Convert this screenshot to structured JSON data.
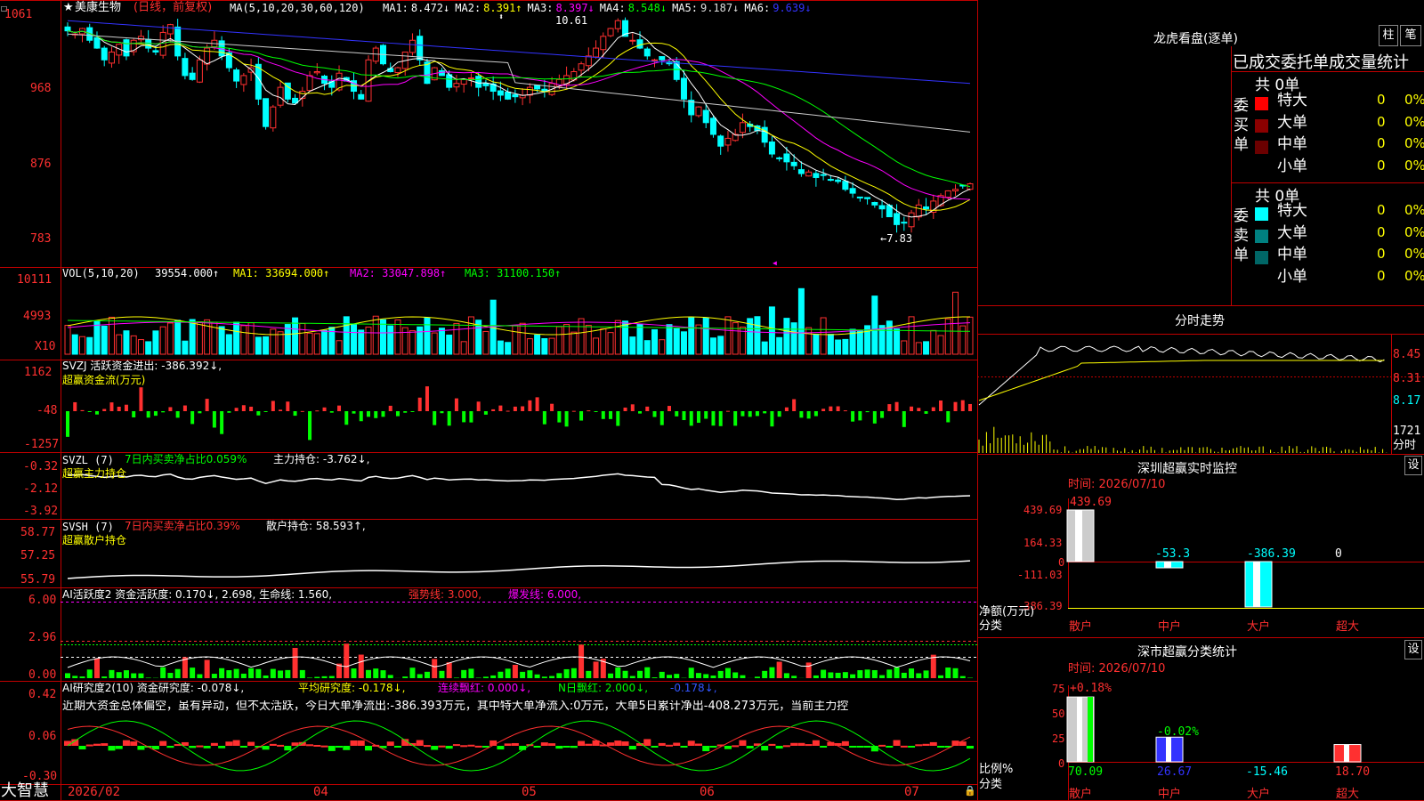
{
  "app": {
    "name": "大智慧"
  },
  "stock": {
    "name": "美康生物",
    "mode": "(日线，前复权)"
  },
  "main_panel": {
    "label": "MA(5,10,20,30,60,120)",
    "ma_readouts": [
      {
        "name": "MA1:",
        "value": "8.472↓",
        "color": "#ffffff"
      },
      {
        "name": "MA2:",
        "value": "8.391↑",
        "color": "#ffff00"
      },
      {
        "name": "MA3:",
        "value": "8.397↓",
        "color": "#ff00ff"
      },
      {
        "name": "MA4:",
        "value": "8.548↓",
        "color": "#00ff00"
      },
      {
        "name": "MA5:",
        "value": "9.187↓",
        "color": "#dddddd"
      },
      {
        "name": "MA6:",
        "value": "9.639↓",
        "color": "#3333ff"
      }
    ],
    "y_ticks": [
      "1061",
      "968",
      "876",
      "783"
    ],
    "high_label": "10.61",
    "low_label": "←7.83"
  },
  "vol_panel": {
    "label": "VOL(5,10,20)",
    "value": "39554.000↑",
    "ma1": "MA1: 33694.000↑",
    "ma2": "MA2: 33047.898↑",
    "ma3": "MA3: 31100.150↑",
    "y_ticks": [
      "10111",
      "4993"
    ],
    "unit": "X10"
  },
  "svzj_panel": {
    "label": "SVZJ  活跃资金进出: -386.392↓,",
    "sub": "超赢资金流(万元)",
    "y_ticks": [
      "1162",
      "-48",
      "-1257"
    ]
  },
  "svzl_panel": {
    "label": "SVZL (7)",
    "ratio": "7日内买卖净占比0.059%",
    "hold": "主力持仓: -3.762↓,",
    "sub": "超赢主力持仓",
    "y_ticks": [
      "-0.32",
      "-2.12",
      "-3.92"
    ]
  },
  "svsh_panel": {
    "label": "SVSH (7)",
    "ratio": "7日内买卖净占比0.39%",
    "hold": "散户持仓: 58.593↑,",
    "sub": "超赢散户持仓",
    "y_ticks": [
      "58.77",
      "57.25",
      "55.79"
    ]
  },
  "ai_active_panel": {
    "label": "AI活跃度2 资金活跃度: 0.170↓, 2.698, 生命线: 1.560,",
    "strong": "强势线: 3.000,",
    "burst": "爆发线: 6.000,",
    "y_ticks": [
      "6.00",
      "2.96",
      "0.00"
    ]
  },
  "ai_research_panel": {
    "label": "AI研究度2(10) 资金研究度: -0.078↓,",
    "avg": "平均研究度: -0.178↓,",
    "cont": "连续飘红: 0.000↓,",
    "nday": "N日飘红: 2.000↓,",
    "last": "-0.178↓,",
    "comment": "近期大资金总体偏空，虽有异动，但不太活跃，今日大单净流出:-386.393万元，其中特大单净流入:0万元，大单5日累计净出-408.273万元，当前主力控",
    "y_ticks": [
      "0.42",
      "0.06",
      "-0.30"
    ]
  },
  "x_axis": {
    "labels": [
      "2026/02",
      "04",
      "05",
      "06",
      "07"
    ]
  },
  "dragon_tiger": {
    "title": "龙虎看盘(逐单)",
    "btn_bar": "柱",
    "btn_pen": "笔",
    "header": "已成交委托单成交量统计",
    "buy_side": "委买单",
    "sell_side": "委卖单",
    "buy_total": "共 0单",
    "sell_total": "共 0单",
    "rows": [
      {
        "label": "特大",
        "value": "0",
        "pct": "0%"
      },
      {
        "label": "大单",
        "value": "0",
        "pct": "0%"
      },
      {
        "label": "中单",
        "value": "0",
        "pct": "0%"
      },
      {
        "label": "小单",
        "value": "0",
        "pct": "0%"
      }
    ],
    "buy_colors": [
      "#ff0000",
      "#8b0000",
      "#6b0000",
      ""
    ],
    "sell_colors": [
      "#00ffff",
      "#008080",
      "#006666",
      ""
    ]
  },
  "intraday": {
    "title": "分时走势",
    "y_ticks": [
      "8.45",
      "8.31",
      "8.17"
    ],
    "vol_tick": "1721",
    "vol_label": "分时"
  },
  "sz_monitor": {
    "title": "深圳超赢实时监控",
    "btn": "设",
    "time": "时间: 2026/07/10",
    "y_ticks": [
      "439.69",
      "164.33",
      "0",
      "-111.03",
      "-386.39"
    ],
    "y_label": "净额(万元)",
    "x_label_title": "分类",
    "categories": [
      "散户",
      "中户",
      "大户",
      "超大"
    ],
    "value_labels": [
      "439.69",
      "-53.3",
      "-386.39",
      "0"
    ]
  },
  "sz_classify": {
    "title": "深市超赢分类统计",
    "btn": "设",
    "time": "时间: 2026/07/10",
    "y_ticks": [
      "75",
      "50",
      "25",
      "0"
    ],
    "y_label": "比例%",
    "x_label_title": "分类",
    "categories": [
      "散户",
      "中户",
      "大户",
      "超大"
    ],
    "top_labels": [
      "+0.18%",
      "-0.02%",
      "",
      ""
    ],
    "bottom_labels": [
      "70.09",
      "26.67",
      "-15.46",
      "18.70"
    ]
  },
  "chart_data": [
    {
      "type": "candlestick",
      "title": "美康生物 (日线，前复权)",
      "y_range": [
        7.5,
        10.7
      ],
      "high": 10.61,
      "low": 7.83,
      "closes": [
        10.42,
        10.38,
        10.45,
        10.3,
        10.2,
        10.05,
        10.15,
        10.25,
        10.1,
        10.3,
        10.35,
        10.2,
        10.15,
        10.4,
        10.5,
        10.1,
        9.85,
        9.8,
        10.05,
        10.2,
        10.3,
        10.1,
        9.95,
        9.78,
        9.85,
        9.95,
        9.55,
        9.2,
        9.45,
        9.7,
        9.55,
        9.5,
        9.65,
        9.85,
        9.9,
        9.75,
        9.7,
        9.88,
        9.78,
        9.65,
        9.55,
        10.05,
        10.2,
        10.0,
        9.9,
        9.95,
        10.15,
        10.3,
        10.05,
        9.75,
        9.95,
        9.85,
        9.7,
        9.75,
        9.8,
        9.82,
        9.7,
        9.72,
        9.65,
        9.6,
        9.55,
        9.58,
        9.6,
        9.7,
        9.68,
        9.65,
        9.75,
        9.8,
        9.85,
        9.9,
        10.0,
        10.1,
        10.2,
        10.35,
        10.45,
        10.55,
        10.35,
        10.3,
        10.2,
        10.1,
        10.05,
        10.05,
        10.0,
        9.8,
        9.55,
        9.35,
        9.45,
        9.25,
        9.1,
        8.95,
        9.05,
        9.1,
        9.25,
        9.2,
        9.15,
        9.0,
        8.85,
        8.8,
        8.75,
        8.7,
        8.6,
        8.62,
        8.55,
        8.58,
        8.52,
        8.5,
        8.4,
        8.35,
        8.3,
        8.28,
        8.2,
        8.15,
        8.05,
        7.95,
        7.98,
        8.1,
        8.2,
        8.15,
        8.25,
        8.32,
        8.38,
        8.4,
        8.45,
        8.47
      ],
      "ma_series": [
        "MA5",
        "MA10",
        "MA20",
        "MA30",
        "MA60",
        "MA120"
      ]
    },
    {
      "type": "bar",
      "title": "VOL(5,10,20)",
      "unit": "X10",
      "latest": 39554.0,
      "ylim": [
        0,
        10111
      ]
    },
    {
      "type": "bar",
      "title": "SVZJ 活跃资金进出",
      "latest": -386.392,
      "ylim": [
        -1257,
        1162
      ]
    },
    {
      "type": "line",
      "title": "SVZL 主力持仓",
      "latest": -3.762,
      "ylim": [
        -3.92,
        -0.32
      ]
    },
    {
      "type": "line",
      "title": "SVSH 散户持仓",
      "latest": 58.593,
      "ylim": [
        55.79,
        58.77
      ]
    },
    {
      "type": "bar",
      "title": "AI活跃度2",
      "latest": 0.17,
      "ylim": [
        0,
        6.0
      ]
    },
    {
      "type": "bar",
      "title": "AI研究度2(10)",
      "latest": -0.078,
      "ylim": [
        -0.3,
        0.42
      ]
    },
    {
      "type": "bar",
      "title": "深圳超赢实时监控",
      "categories": [
        "散户",
        "中户",
        "大户",
        "超大"
      ],
      "values": [
        439.69,
        -53.3,
        -386.39,
        0
      ]
    },
    {
      "type": "bar",
      "title": "深市超赢分类统计",
      "categories": [
        "散户",
        "中户",
        "大户",
        "超大"
      ],
      "values": [
        70.09,
        26.67,
        -15.46,
        18.7
      ]
    }
  ]
}
